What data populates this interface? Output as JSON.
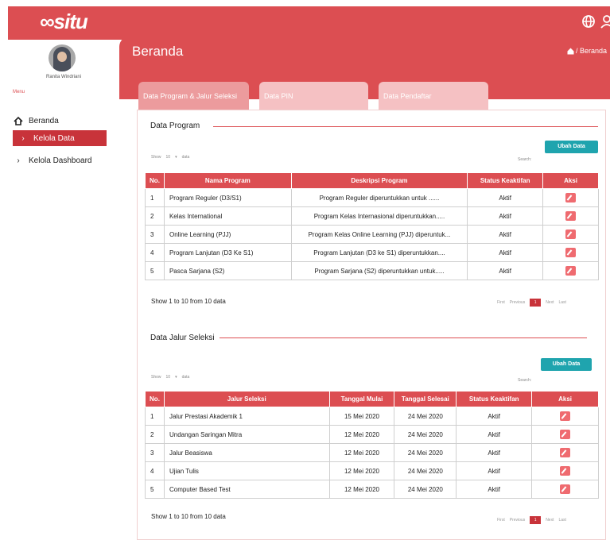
{
  "app": {
    "logo": "situ"
  },
  "user": {
    "name": "Ranita Windriani"
  },
  "sidebar": {
    "menu_label": "Menu",
    "items": [
      {
        "label": "Beranda",
        "icon": "home-icon"
      },
      {
        "label": "Kelola Data",
        "icon": "chevron-right-icon",
        "active": true
      },
      {
        "label": "Kelola Dashboard",
        "icon": "chevron-right-icon"
      }
    ]
  },
  "page": {
    "title": "Beranda",
    "breadcrumb": "/ Beranda"
  },
  "tabs": [
    {
      "label": "Data Program & Jalur Seleksi",
      "active": true
    },
    {
      "label": "Data PIN"
    },
    {
      "label": "Data Pendaftar"
    }
  ],
  "program": {
    "section_title": "Data Program",
    "show_label": "Show",
    "show_value": "10",
    "show_suffix": "data",
    "search_label": "Search:",
    "button": "Ubah Data",
    "columns": [
      "No.",
      "Nama Program",
      "Deskripsi Program",
      "Status Keaktifan",
      "Aksi"
    ],
    "rows": [
      {
        "no": "1",
        "nama": "Program Reguler (D3/S1)",
        "deskripsi": "Program Reguler diperuntukkan untuk ......",
        "status": "Aktif"
      },
      {
        "no": "2",
        "nama": "Kelas International",
        "deskripsi": "Program Kelas Internasional diperuntukkan.....",
        "status": "Aktif"
      },
      {
        "no": "3",
        "nama": "Online Learning (PJJ)",
        "deskripsi": "Program Kelas Online Learning (PJJ) diperuntuk...",
        "status": "Aktif"
      },
      {
        "no": "4",
        "nama": "Program Lanjutan (D3 Ke S1)",
        "deskripsi": "Program Lanjutan (D3 ke S1) diperuntukkan....",
        "status": "Aktif"
      },
      {
        "no": "5",
        "nama": "Pasca Sarjana (S2)",
        "deskripsi": "Program Sarjana (S2) diperuntukkan untuk.....",
        "status": "Aktif"
      }
    ],
    "info": "Show 1 to 10 from 10 data"
  },
  "jalur": {
    "section_title": "Data Jalur Seleksi",
    "show_label": "Show",
    "show_value": "10",
    "show_suffix": "data",
    "search_label": "Search:",
    "button": "Ubah Data",
    "columns": [
      "No.",
      "Jalur Seleksi",
      "Tanggal Mulai",
      "Tanggal Selesai",
      "Status Keaktifan",
      "Aksi"
    ],
    "rows": [
      {
        "no": "1",
        "jalur": "Jalur Prestasi Akademik 1",
        "mulai": "15 Mei 2020",
        "selesai": "24 Mei 2020",
        "status": "Aktif"
      },
      {
        "no": "2",
        "jalur": "Undangan Saringan Mitra",
        "mulai": "12 Mei 2020",
        "selesai": "24 Mei 2020",
        "status": "Aktif"
      },
      {
        "no": "3",
        "jalur": "Jalur Beasiswa",
        "mulai": "12 Mei 2020",
        "selesai": "24 Mei 2020",
        "status": "Aktif"
      },
      {
        "no": "4",
        "jalur": "Ujian Tulis",
        "mulai": "12 Mei 2020",
        "selesai": "24 Mei 2020",
        "status": "Aktif"
      },
      {
        "no": "5",
        "jalur": "Computer Based Test",
        "mulai": "12 Mei 2020",
        "selesai": "24 Mei 2020",
        "status": "Aktif"
      }
    ],
    "info": "Show 1 to 10 from 10 data"
  },
  "pagination": {
    "first": "First",
    "previous": "Previous",
    "current": "1",
    "next": "Next",
    "last": "Last"
  },
  "colors": {
    "primary": "#dc4e52",
    "active_nav": "#c8333a",
    "button_teal": "#1fa4ae"
  }
}
